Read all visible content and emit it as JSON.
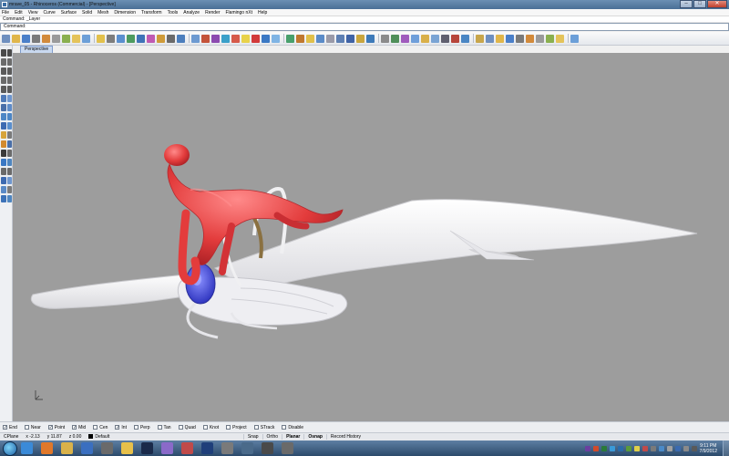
{
  "window": {
    "title": "mrave_05 - Rhinoceros (Commercial) - [Perspective]",
    "controls": [
      "–",
      "□",
      "✕"
    ]
  },
  "menubar": {
    "items": [
      "File",
      "Edit",
      "View",
      "Curve",
      "Surface",
      "Solid",
      "Mesh",
      "Dimension",
      "Transform",
      "Tools",
      "Analyze",
      "Render",
      "Flamingo nXt",
      "Help"
    ]
  },
  "command": {
    "history": "Command: _Layer",
    "prompt": "Command:",
    "value": ""
  },
  "toolbar": {
    "icons": [
      "new-icon",
      "open-icon",
      "save-icon",
      "print-icon",
      "import-icon",
      "cut-icon",
      "copy-icon",
      "paste-icon",
      "undo-icon",
      "pan-icon",
      "rotate-view-icon",
      "zoom-icon",
      "zoom-window-icon",
      "zoom-extents-icon",
      "zoom-selected-icon",
      "zoom-target-icon",
      "zoom-dynamic-icon",
      "set-view-icon",
      "named-view-icon",
      "cplane-icon",
      "set-cplane-icon",
      "hide-icon",
      "show-icon",
      "lock-icon",
      "unlock-icon",
      "layer-icon",
      "properties-icon",
      "render-icon",
      "material-icon",
      "environment-icon",
      "wireframe-icon",
      "shaded-icon",
      "rendered-icon",
      "ghosted-icon",
      "xray-icon",
      "help-icon",
      "options-icon",
      "grid-icon",
      "snap-icon",
      "ortho-icon",
      "planar-icon",
      "osnap-icon",
      "history-icon",
      "analysis-icon",
      "curvature-icon",
      "zebra-icon",
      "environment-map-icon",
      "draft-angle-icon",
      "edge-icon",
      "naked-edge-icon",
      "mesh-icon",
      "camera-icon",
      "light-icon",
      "sun-icon",
      "flamingo-icon"
    ],
    "colors": [
      "#6e8fbf",
      "#e0b64a",
      "#4a7fc9",
      "#7a7a7a",
      "#d28a3b",
      "#9a9a9a",
      "#8ab04f",
      "#e4c35a",
      "#6c9fd8",
      "#e2c14c",
      "#7d7d7d",
      "#5a8fcf",
      "#4d9b5f",
      "#3f73b8",
      "#c05ab2",
      "#cf9b39",
      "#6a6a6a",
      "#4c7ebd",
      "#6d9ad1",
      "#c4533a",
      "#8c4ab0",
      "#3aa0c9",
      "#d65a4a",
      "#e8d24a",
      "#d23a3a",
      "#3a78c4",
      "#7fb4e4",
      "#48a06c",
      "#c0782f",
      "#e0c04a",
      "#5a8bc8",
      "#9a9aa8",
      "#5d7fb3",
      "#3f63a6",
      "#c9a63e",
      "#3d7ab9",
      "#8b8b8b",
      "#4f8f5a",
      "#a05bbd",
      "#6f9fda",
      "#d9b04a",
      "#7aa4d4",
      "#5f5f6f",
      "#b7453b",
      "#4a86c4",
      "#c8a64b"
    ]
  },
  "palette": {
    "icons": [
      "select-icon",
      "point-icon",
      "polyline-icon",
      "curve-icon",
      "circle-icon",
      "arc-icon",
      "ellipse-icon",
      "polygon-icon",
      "rectangle-icon",
      "freeform-icon",
      "fillet-icon",
      "offset-icon",
      "surface-icon",
      "extrude-icon",
      "loft-icon",
      "sweep-icon",
      "box-icon",
      "sphere-icon",
      "boolean-icon",
      "mesh-icon",
      "move-icon",
      "rotate-icon",
      "scale-icon",
      "mirror-icon",
      "array-icon",
      "trim-icon",
      "split-icon",
      "join-icon",
      "explode-icon",
      "group-icon",
      "dimension-icon",
      "text-icon",
      "render-icon",
      "material-icon"
    ],
    "colors": [
      "#4a4a4a",
      "#4a4a4a",
      "#6b6b6b",
      "#6b6b6b",
      "#5a5a5a",
      "#5a5a5a",
      "#6a6a6a",
      "#6a6a6a",
      "#5a5a5a",
      "#5a5a5a",
      "#4f7ab8",
      "#6f97cf",
      "#4a6fa8",
      "#5f8cc8",
      "#4d86c5",
      "#4d86c5",
      "#3d6ab1",
      "#5b8fcd",
      "#d7a43a",
      "#7a7a7a",
      "#d28a2f",
      "#4a6fa8",
      "#3a3a3a",
      "#6a6a6a",
      "#3a78c4",
      "#4f86c0",
      "#6a6a6a",
      "#6a6a6a",
      "#3d6ab1",
      "#6f97cf",
      "#5a8ac6",
      "#7a7a7a",
      "#3c72b8",
      "#4f86c0"
    ]
  },
  "viewport": {
    "tab_label": "Perspective",
    "background": "#9d9d9d"
  },
  "osnap": {
    "items": [
      {
        "label": "End",
        "checked": true
      },
      {
        "label": "Near",
        "checked": false
      },
      {
        "label": "Point",
        "checked": true
      },
      {
        "label": "Mid",
        "checked": true
      },
      {
        "label": "Cen",
        "checked": false
      },
      {
        "label": "Int",
        "checked": true
      },
      {
        "label": "Perp",
        "checked": false
      },
      {
        "label": "Tan",
        "checked": false
      },
      {
        "label": "Quad",
        "checked": false
      },
      {
        "label": "Knot",
        "checked": false
      },
      {
        "label": "Project",
        "checked": false
      },
      {
        "label": "STrack",
        "checked": false
      },
      {
        "label": "Disable",
        "checked": false
      }
    ]
  },
  "statusbar": {
    "cplane": "CPlane",
    "x": "x -2.13",
    "y": "y 11.87",
    "z": "z 0.00",
    "layer": "Default",
    "panes": [
      {
        "label": "Snap",
        "active": false
      },
      {
        "label": "Ortho",
        "active": false
      },
      {
        "label": "Planar",
        "active": true
      },
      {
        "label": "Osnap",
        "active": true
      },
      {
        "label": "Record History",
        "active": false
      }
    ]
  },
  "taskbar": {
    "apps": [
      "ie-icon",
      "firefox-icon",
      "explorer-icon",
      "media-player-icon",
      "rhino-icon",
      "windows-explorer-icon",
      "steam-icon",
      "tool-icon",
      "media-icon",
      "photoshop-icon",
      "paint-icon",
      "app-icon",
      "app-icon-2",
      "rhino-active-icon"
    ],
    "app_colors": [
      "#3a8ad8",
      "#e0782a",
      "#d9b24a",
      "#3a6fc0",
      "#6a6a6a",
      "#e7c04a",
      "#1a2a4a",
      "#8a6ac9",
      "#c04a4a",
      "#1f3f7a",
      "#7a7a7a",
      "#4a6a8a",
      "#4a4a4a",
      "#6a6a6a"
    ],
    "tray_colors": [
      "#6a3fa0",
      "#d04a2a",
      "#2a7a3a",
      "#3a9ad8",
      "#2a6aa8",
      "#5a9a3a",
      "#e0d04a",
      "#c04a4a",
      "#7a7a7a",
      "#4a8ac8",
      "#a0a0a0",
      "#3a6ab0",
      "#8a8a8a",
      "#5a5a5a"
    ],
    "clock_time": "9:11 PM",
    "clock_date": "7/9/2012"
  },
  "colors": {
    "figure": "#e33c3c",
    "wing": "#f4f4f6",
    "cockpit": "#5a60e0",
    "strap": "#8a7040"
  }
}
